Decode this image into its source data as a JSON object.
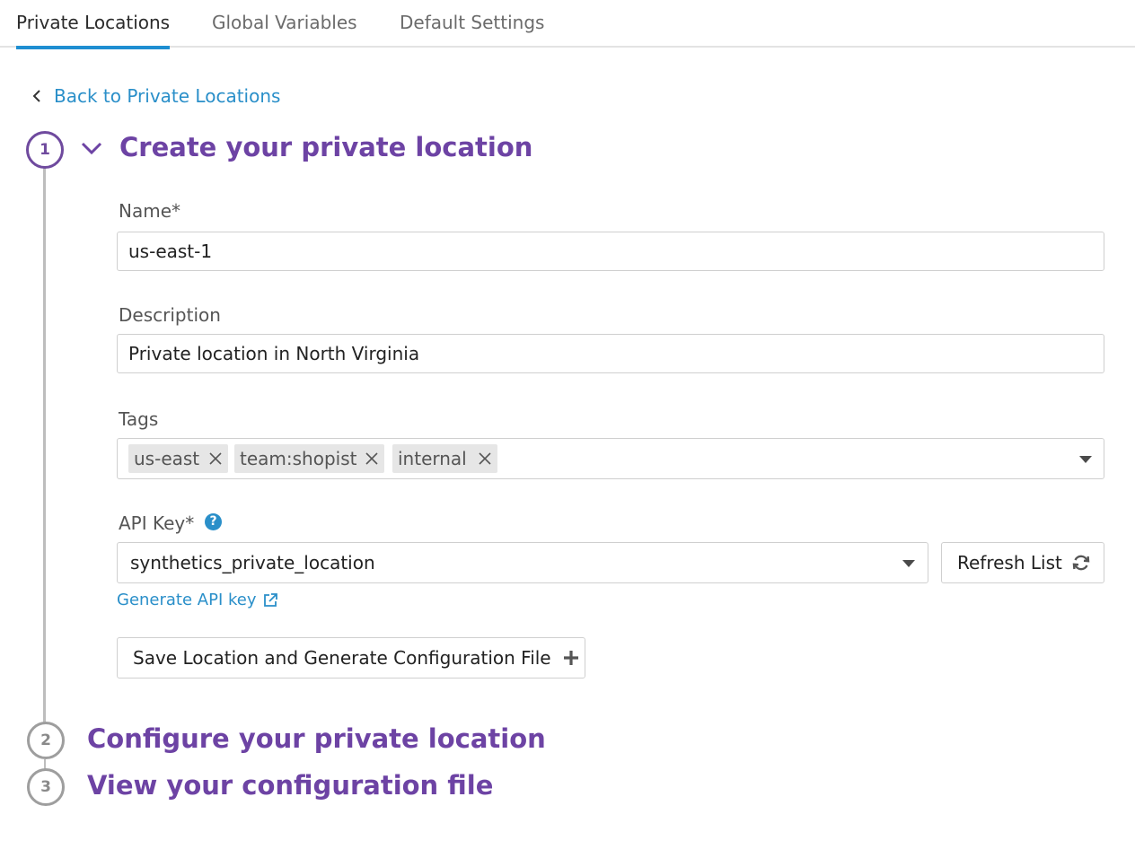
{
  "tabs": [
    {
      "label": "Private Locations",
      "active": true
    },
    {
      "label": "Global Variables",
      "active": false
    },
    {
      "label": "Default Settings",
      "active": false
    }
  ],
  "back_link": "Back to Private Locations",
  "steps": [
    {
      "number": "1",
      "title": "Create your private location",
      "expanded": true
    },
    {
      "number": "2",
      "title": "Configure your private location",
      "expanded": false
    },
    {
      "number": "3",
      "title": "View your configuration file",
      "expanded": false
    }
  ],
  "form": {
    "name_label": "Name*",
    "name_value": "us-east-1",
    "description_label": "Description",
    "description_value": "Private location in North Virginia",
    "tags_label": "Tags",
    "tags": [
      "us-east",
      "team:shopist",
      "internal"
    ],
    "api_key_label": "API Key*",
    "api_key_help": "?",
    "api_key_value": "synthetics_private_location",
    "refresh_label": "Refresh List",
    "generate_link": "Generate API key",
    "save_label": "Save Location and Generate Configuration File"
  },
  "colors": {
    "accent": "#6d43a4",
    "link": "#2a8fc9",
    "tab_underline": "#1e8ed1"
  }
}
